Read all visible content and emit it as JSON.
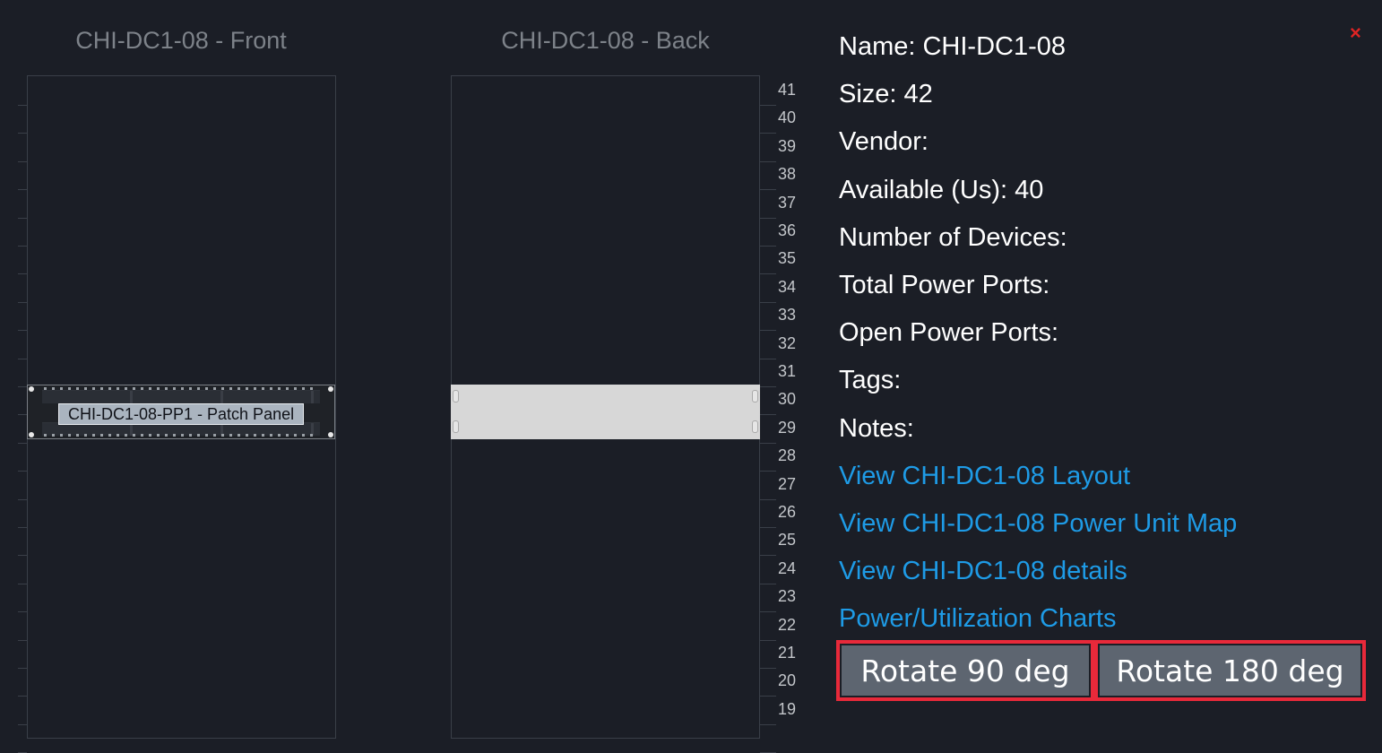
{
  "front_rack": {
    "title": "CHI-DC1-08 - Front",
    "device_label": "CHI-DC1-08-PP1 - Patch Panel"
  },
  "back_rack": {
    "title": "CHI-DC1-08 - Back",
    "unit_labels": [
      "41",
      "40",
      "39",
      "38",
      "37",
      "36",
      "35",
      "34",
      "33",
      "32",
      "31",
      "30",
      "29",
      "28",
      "27",
      "26",
      "25",
      "24",
      "23",
      "22",
      "21",
      "20",
      "19"
    ]
  },
  "info": {
    "name": "Name: CHI-DC1-08",
    "size": "Size: 42",
    "vendor": "Vendor:",
    "available": "Available (Us): 40",
    "num_devices": "Number of Devices:",
    "total_power_ports": "Total Power Ports:",
    "open_power_ports": "Open Power Ports:",
    "tags": "Tags:",
    "notes": "Notes:"
  },
  "links": {
    "layout": "View CHI-DC1-08 Layout",
    "power_map": "View CHI-DC1-08 Power Unit Map",
    "details": "View CHI-DC1-08 details",
    "charts": "Power/Utilization Charts"
  },
  "buttons": {
    "rotate_90": "Rotate 90 deg",
    "rotate_180": "Rotate 180 deg",
    "close": "×"
  },
  "colors": {
    "background": "#1b1e26",
    "link": "#1e9be6",
    "button": "#5d6570",
    "highlight": "#e8293a",
    "close": "#e02424"
  }
}
